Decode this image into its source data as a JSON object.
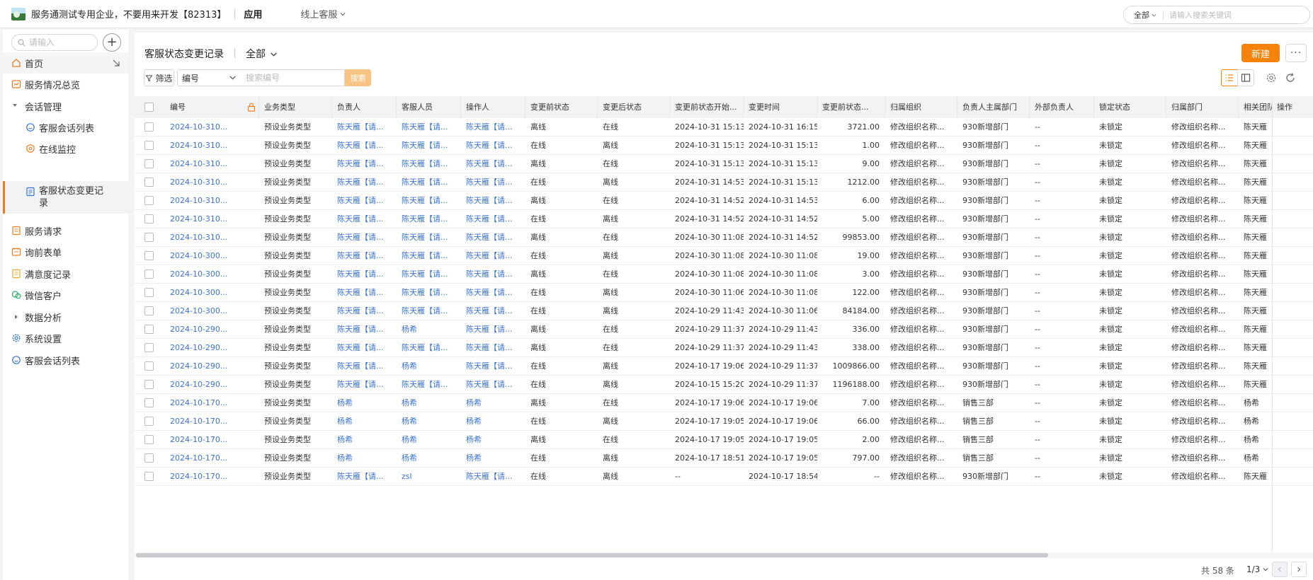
{
  "topbar": {
    "tenant_name": "服务通测试专用企业，不要用来开发【82313】",
    "app_label": "应用",
    "service_label": "线上客服",
    "search_scope": "全部",
    "search_placeholder": "请输入搜索关键词"
  },
  "sidebar": {
    "search_placeholder": "请输入",
    "add_label": "+",
    "items": [
      {
        "label": "首页",
        "icon": "home-icon"
      },
      {
        "label": "服务情况总览",
        "icon": "overview-icon"
      },
      {
        "label": "会话管理",
        "icon": "caret-down-icon"
      },
      {
        "label": "客服会话列表",
        "icon": "chat-bubble-icon"
      },
      {
        "label": "在线监控",
        "icon": "monitor-shield-icon"
      },
      {
        "label": "客服状态变更记录",
        "icon": "record-icon"
      },
      {
        "label": "服务请求",
        "icon": "request-icon"
      },
      {
        "label": "询前表单",
        "icon": "form-icon"
      },
      {
        "label": "满意度记录",
        "icon": "satisfaction-icon"
      },
      {
        "label": "微信客户",
        "icon": "wechat-icon"
      },
      {
        "label": "数据分析",
        "icon": "caret-right-icon"
      },
      {
        "label": "系统设置",
        "icon": "gear-icon"
      },
      {
        "label": "客服会话列表",
        "icon": "chat-bubble-icon"
      }
    ]
  },
  "main": {
    "title": "客服状态变更记录",
    "view_select": "全部",
    "new_label": "新建",
    "more_label": "···",
    "filter_label": "筛选",
    "field_select": "编号",
    "keyword_placeholder": "搜索编号",
    "search_label": "搜索"
  },
  "table": {
    "columns": [
      "编号",
      "业务类型",
      "负责人",
      "客服人员",
      "操作人",
      "变更前状态",
      "变更后状态",
      "变更前状态开始...",
      "变更时间",
      "变更前状态...",
      "归属组织",
      "负责人主属部门",
      "外部负责人",
      "锁定状态",
      "归属部门",
      "相关团队",
      "操作"
    ],
    "rows": [
      [
        "2024-10-310...",
        "预设业务类型",
        "陈天雁【请...",
        "陈天雁【请...",
        "陈天雁【请...",
        "离线",
        "在线",
        "2024-10-31 15:13",
        "2024-10-31 16:15",
        "3721.00",
        "修改组织名称...",
        "930新增部门",
        "--",
        "未锁定",
        "修改组织名称...",
        "陈天雁【请..."
      ],
      [
        "2024-10-310...",
        "预设业务类型",
        "陈天雁【请...",
        "陈天雁【请...",
        "陈天雁【请...",
        "在线",
        "离线",
        "2024-10-31 15:13",
        "2024-10-31 15:13",
        "1.00",
        "修改组织名称...",
        "930新增部门",
        "--",
        "未锁定",
        "修改组织名称...",
        "陈天雁【请..."
      ],
      [
        "2024-10-310...",
        "预设业务类型",
        "陈天雁【请...",
        "陈天雁【请...",
        "陈天雁【请...",
        "离线",
        "在线",
        "2024-10-31 15:13",
        "2024-10-31 15:13",
        "9.00",
        "修改组织名称...",
        "930新增部门",
        "--",
        "未锁定",
        "修改组织名称...",
        "陈天雁【请..."
      ],
      [
        "2024-10-310...",
        "预设业务类型",
        "陈天雁【请...",
        "陈天雁【请...",
        "陈天雁【请...",
        "在线",
        "离线",
        "2024-10-31 14:53",
        "2024-10-31 15:13",
        "1212.00",
        "修改组织名称...",
        "930新增部门",
        "--",
        "未锁定",
        "修改组织名称...",
        "陈天雁【请..."
      ],
      [
        "2024-10-310...",
        "预设业务类型",
        "陈天雁【请...",
        "陈天雁【请...",
        "陈天雁【请...",
        "离线",
        "在线",
        "2024-10-31 14:52",
        "2024-10-31 14:53",
        "6.00",
        "修改组织名称...",
        "930新增部门",
        "--",
        "未锁定",
        "修改组织名称...",
        "陈天雁【请..."
      ],
      [
        "2024-10-310...",
        "预设业务类型",
        "陈天雁【请...",
        "陈天雁【请...",
        "陈天雁【请...",
        "在线",
        "离线",
        "2024-10-31 14:52",
        "2024-10-31 14:52",
        "5.00",
        "修改组织名称...",
        "930新增部门",
        "--",
        "未锁定",
        "修改组织名称...",
        "陈天雁【请..."
      ],
      [
        "2024-10-310...",
        "预设业务类型",
        "陈天雁【请...",
        "陈天雁【请...",
        "陈天雁【请...",
        "离线",
        "在线",
        "2024-10-30 11:08",
        "2024-10-31 14:52",
        "99853.00",
        "修改组织名称...",
        "930新增部门",
        "--",
        "未锁定",
        "修改组织名称...",
        "陈天雁【请..."
      ],
      [
        "2024-10-300...",
        "预设业务类型",
        "陈天雁【请...",
        "陈天雁【请...",
        "陈天雁【请...",
        "在线",
        "离线",
        "2024-10-30 11:08",
        "2024-10-30 11:08",
        "19.00",
        "修改组织名称...",
        "930新增部门",
        "--",
        "未锁定",
        "修改组织名称...",
        "陈天雁【请..."
      ],
      [
        "2024-10-300...",
        "预设业务类型",
        "陈天雁【请...",
        "陈天雁【请...",
        "陈天雁【请...",
        "离线",
        "在线",
        "2024-10-30 11:08",
        "2024-10-30 11:08",
        "3.00",
        "修改组织名称...",
        "930新增部门",
        "--",
        "未锁定",
        "修改组织名称...",
        "陈天雁【请..."
      ],
      [
        "2024-10-300...",
        "预设业务类型",
        "陈天雁【请...",
        "陈天雁【请...",
        "陈天雁【请...",
        "在线",
        "离线",
        "2024-10-30 11:06",
        "2024-10-30 11:08",
        "122.00",
        "修改组织名称...",
        "930新增部门",
        "--",
        "未锁定",
        "修改组织名称...",
        "陈天雁【请..."
      ],
      [
        "2024-10-300...",
        "预设业务类型",
        "陈天雁【请...",
        "陈天雁【请...",
        "陈天雁【请...",
        "在线",
        "离线",
        "2024-10-29 11:43",
        "2024-10-30 11:06",
        "84184.00",
        "修改组织名称...",
        "930新增部门",
        "--",
        "未锁定",
        "修改组织名称...",
        "陈天雁【请..."
      ],
      [
        "2024-10-290...",
        "预设业务类型",
        "陈天雁【请...",
        "杨希",
        "陈天雁【请...",
        "离线",
        "在线",
        "2024-10-29 11:37",
        "2024-10-29 11:43",
        "336.00",
        "修改组织名称...",
        "930新增部门",
        "--",
        "未锁定",
        "修改组织名称...",
        "陈天雁【请..."
      ],
      [
        "2024-10-290...",
        "预设业务类型",
        "陈天雁【请...",
        "陈天雁【请...",
        "陈天雁【请...",
        "离线",
        "在线",
        "2024-10-29 11:37",
        "2024-10-29 11:43",
        "338.00",
        "修改组织名称...",
        "930新增部门",
        "--",
        "未锁定",
        "修改组织名称...",
        "陈天雁【请..."
      ],
      [
        "2024-10-290...",
        "预设业务类型",
        "陈天雁【请...",
        "杨希",
        "陈天雁【请...",
        "在线",
        "离线",
        "2024-10-17 19:06",
        "2024-10-29 11:37",
        "1009866.00",
        "修改组织名称...",
        "930新增部门",
        "--",
        "未锁定",
        "修改组织名称...",
        "陈天雁【请..."
      ],
      [
        "2024-10-290...",
        "预设业务类型",
        "陈天雁【请...",
        "陈天雁【请...",
        "陈天雁【请...",
        "在线",
        "离线",
        "2024-10-15 15:20",
        "2024-10-29 11:37",
        "1196188.00",
        "修改组织名称...",
        "930新增部门",
        "--",
        "未锁定",
        "修改组织名称...",
        "陈天雁【请..."
      ],
      [
        "2024-10-170...",
        "预设业务类型",
        "杨希",
        "杨希",
        "杨希",
        "离线",
        "在线",
        "2024-10-17 19:06",
        "2024-10-17 19:06",
        "7.00",
        "修改组织名称...",
        "销售三部",
        "--",
        "未锁定",
        "修改组织名称...",
        "杨希"
      ],
      [
        "2024-10-170...",
        "预设业务类型",
        "杨希",
        "杨希",
        "杨希",
        "在线",
        "离线",
        "2024-10-17 19:05",
        "2024-10-17 19:06",
        "66.00",
        "修改组织名称...",
        "销售三部",
        "--",
        "未锁定",
        "修改组织名称...",
        "杨希"
      ],
      [
        "2024-10-170...",
        "预设业务类型",
        "杨希",
        "杨希",
        "杨希",
        "离线",
        "在线",
        "2024-10-17 19:05",
        "2024-10-17 19:05",
        "2.00",
        "修改组织名称...",
        "销售三部",
        "--",
        "未锁定",
        "修改组织名称...",
        "杨希"
      ],
      [
        "2024-10-170...",
        "预设业务类型",
        "杨希",
        "杨希",
        "杨希",
        "在线",
        "离线",
        "2024-10-17 18:51",
        "2024-10-17 19:05",
        "797.00",
        "修改组织名称...",
        "销售三部",
        "--",
        "未锁定",
        "修改组织名称...",
        "杨希"
      ],
      [
        "2024-10-170...",
        "预设业务类型",
        "陈天雁【请...",
        "zsl",
        "陈天雁【请...",
        "在线",
        "离线",
        "--",
        "2024-10-17 18:54",
        "--",
        "修改组织名称...",
        "930新增部门",
        "--",
        "未锁定",
        "修改组织名称...",
        "陈天雁【请..."
      ]
    ]
  },
  "pagination": {
    "total": "共 58 条",
    "page": "1/3"
  },
  "colors": {
    "accent": "#f5820b",
    "link": "#3a73d6",
    "search_button": "#f9c483",
    "header_bg": "#f2f3f5"
  }
}
